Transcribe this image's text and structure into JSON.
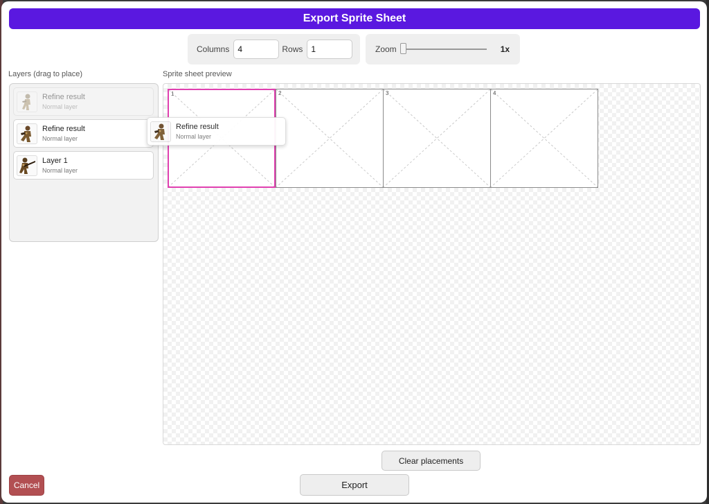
{
  "dialog": {
    "title": "Export Sprite Sheet"
  },
  "grid": {
    "columns_label": "Columns",
    "columns_value": "4",
    "rows_label": "Rows",
    "rows_value": "1"
  },
  "zoom": {
    "label": "Zoom",
    "value_text": "1x",
    "level": 0
  },
  "layers": {
    "heading": "Layers (drag to place)",
    "items": [
      {
        "name": "Refine result",
        "type": "Normal layer",
        "state": "dragging-source",
        "icon": "sprite-soldier-icon"
      },
      {
        "name": "Refine result",
        "type": "Normal layer",
        "state": "normal",
        "icon": "sprite-soldier-icon"
      },
      {
        "name": "Layer 1",
        "type": "Normal layer",
        "state": "normal",
        "icon": "sprite-soldier-rifle-icon"
      }
    ],
    "drag_ghost": {
      "name": "Refine result",
      "type": "Normal layer",
      "icon": "sprite-soldier-icon"
    }
  },
  "preview": {
    "heading": "Sprite sheet preview",
    "cells": [
      "1",
      "2",
      "3",
      "4"
    ],
    "active_cell": 0,
    "highlight_color": "#e040b0"
  },
  "actions": {
    "clear": "Clear placements",
    "export": "Export",
    "cancel": "Cancel"
  },
  "colors": {
    "title_bar": "#5a18e0",
    "cancel": "#b24f52"
  }
}
